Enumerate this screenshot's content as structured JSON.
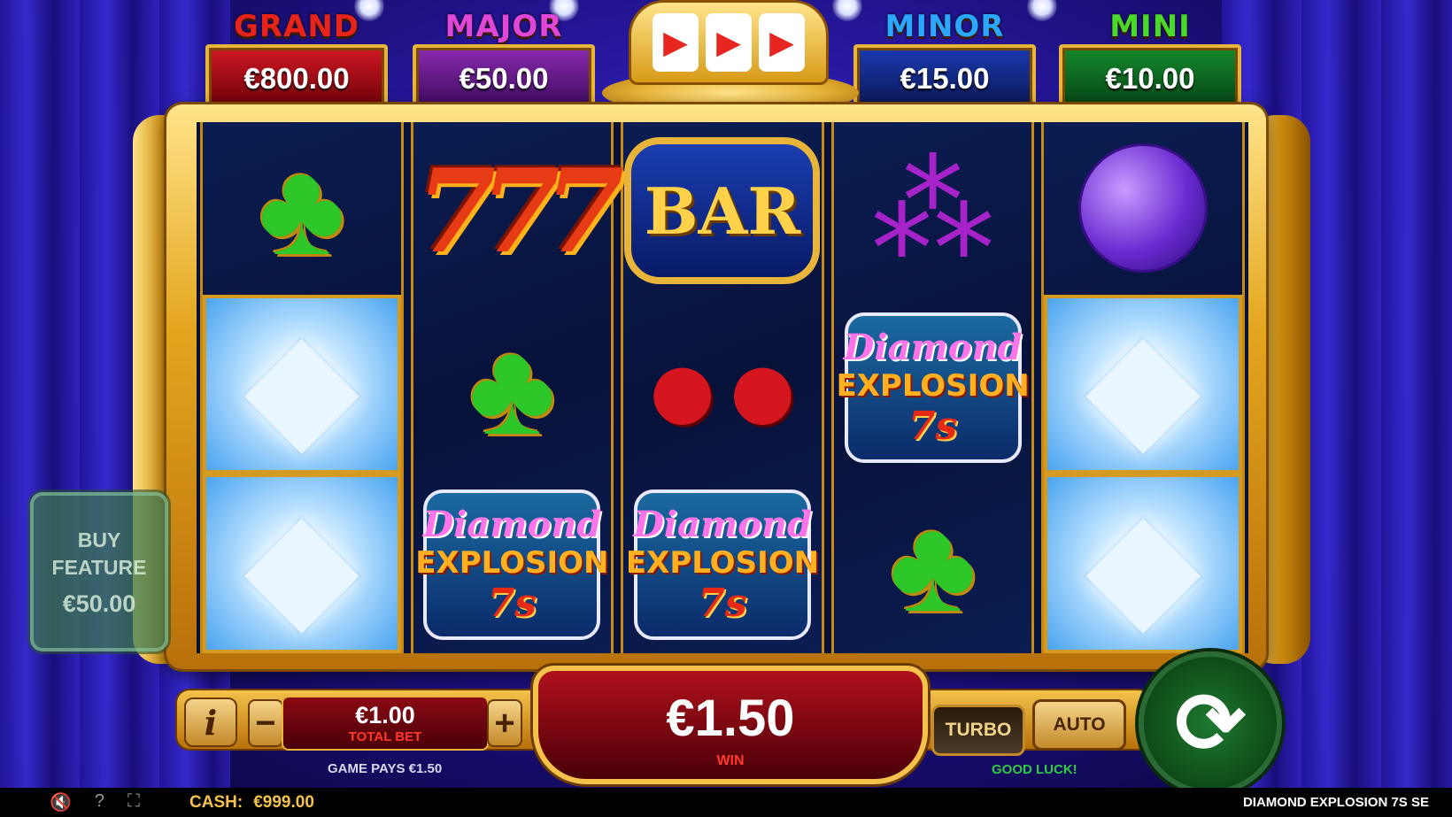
{
  "jackpots": [
    {
      "title": "GRAND",
      "value": "€800.00",
      "title_color": "#e8241a",
      "box_color": "#b0101c"
    },
    {
      "title": "MAJOR",
      "value": "€50.00",
      "title_color": "#e046d8",
      "box_color": "#6a1a8a"
    },
    {
      "title": "MINOR",
      "value": "€15.00",
      "title_color": "#2aa8ff",
      "box_color": "#132a88"
    },
    {
      "title": "MINI",
      "value": "€10.00",
      "title_color": "#4ad82a",
      "box_color": "#0e6a22"
    }
  ],
  "reels": [
    [
      "clover",
      "diamond",
      "diamond"
    ],
    [
      "triple-seven",
      "clover",
      "logo"
    ],
    [
      "bar",
      "cherry",
      "logo"
    ],
    [
      "grapes",
      "logo",
      "clover"
    ],
    [
      "plum",
      "diamond",
      "diamond"
    ]
  ],
  "symbols": {
    "bar_label": "BAR",
    "seven_label": "777",
    "logo_line1": "Diamond",
    "logo_line2": "EXPLOSION",
    "logo_line3": "7s"
  },
  "buy_feature": {
    "line1": "BUY",
    "line2": "FEATURE",
    "price": "€50.00"
  },
  "controls": {
    "info_label": "i",
    "minus_label": "−",
    "plus_label": "+",
    "total_bet_value": "€1.00",
    "total_bet_label": "TOTAL BET",
    "win_value": "€1.50",
    "win_label": "WIN",
    "turbo_label": "TURBO",
    "auto_label": "AUTO",
    "spin_icon": "refresh-arrows-icon",
    "game_pays": "GAME PAYS €1.50",
    "good_luck": "GOOD LUCK!"
  },
  "statusbar": {
    "cash_label": "CASH:",
    "cash_value": "€999.00",
    "game_name": "DIAMOND EXPLOSION 7S SE",
    "icons": [
      "speaker-muted-icon",
      "help-icon",
      "fullscreen-icon"
    ]
  }
}
